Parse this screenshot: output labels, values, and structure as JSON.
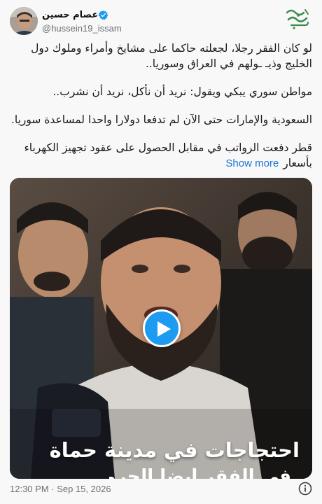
{
  "author": {
    "display_name": "عصام حسين",
    "handle": "@hussein19_issam",
    "verified": true
  },
  "tweet": {
    "paragraphs": [
      "لو كان الفقر رجلا، لجعلته حاكما على مشايخ وأمراء وملوك دول الخليج وذيـ ـولهم في العراق وسوريا..",
      "مواطن سوري يبكي ويقول: نريد أن نأكل، نريد أن نشرب..",
      "السعودية والإمارات حتى الآن لم تدفعا دولارا واحدا لمساعدة سوريا.",
      "قطر دفعت الرواتب في مقابل الحصول على عقود تجهيز الكهرباء بأسعار"
    ],
    "show_more_label": "Show more"
  },
  "media": {
    "type": "video",
    "caption_line1": "احتجاجات في مدينة حماة",
    "caption_line2": "في الفقر أيضا الحرمان"
  },
  "footer": {
    "timestamp": "12:30 PM · Sep 15, 2026"
  },
  "icons": {
    "verified": "verified-badge-icon",
    "play": "play-icon",
    "info": "info-icon",
    "logo": "calligraphy-logo-icon"
  },
  "colors": {
    "accent": "#1d9bf0",
    "link": "#1d75d6",
    "logo": "#3d8a4e",
    "text": "#16181c",
    "muted": "#6b6f74"
  }
}
